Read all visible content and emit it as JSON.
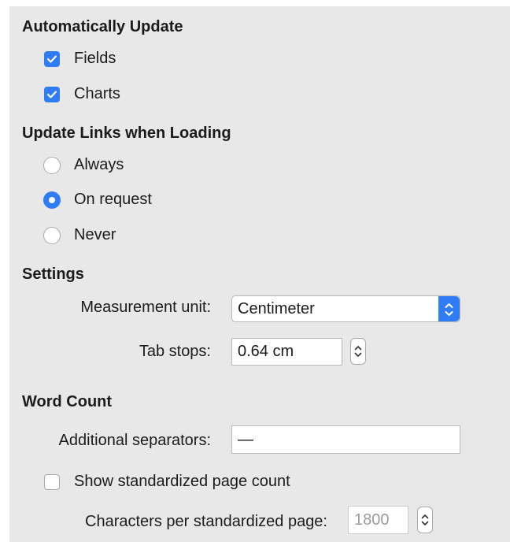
{
  "auto_update": {
    "heading": "Automatically Update",
    "fields": {
      "label": "Fields",
      "checked": true
    },
    "charts": {
      "label": "Charts",
      "checked": true
    }
  },
  "update_links": {
    "heading": "Update Links when Loading",
    "options": [
      {
        "label": "Always",
        "selected": false
      },
      {
        "label": "On request",
        "selected": true
      },
      {
        "label": "Never",
        "selected": false
      }
    ]
  },
  "settings": {
    "heading": "Settings",
    "measurement_unit": {
      "label": "Measurement unit:",
      "value": "Centimeter"
    },
    "tab_stops": {
      "label": "Tab stops:",
      "value": "0.64 cm"
    }
  },
  "word_count": {
    "heading": "Word Count",
    "additional_separators": {
      "label": "Additional separators:",
      "value": "—"
    },
    "show_standardized": {
      "label": "Show standardized page count",
      "checked": false
    },
    "chars_per_page": {
      "label": "Characters per standardized page:",
      "value": "1800"
    }
  },
  "colors": {
    "accent": "#2f7cf6",
    "panel": "#e8e8e8"
  }
}
